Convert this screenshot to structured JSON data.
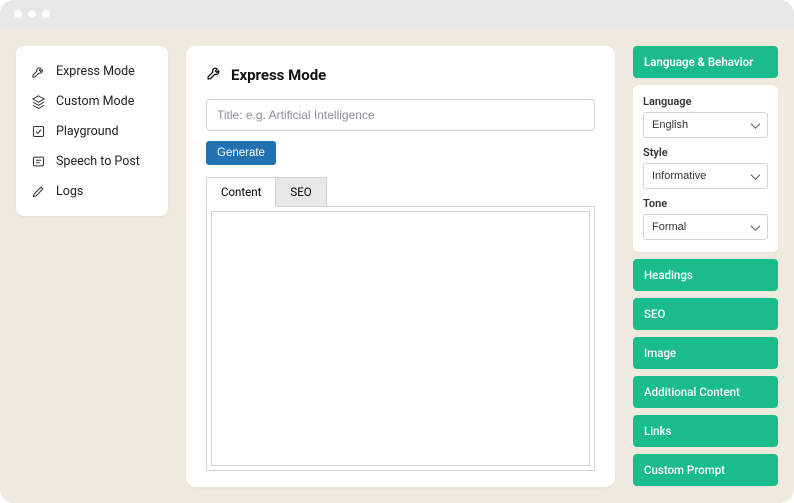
{
  "sidebar": {
    "items": [
      {
        "label": "Express Mode",
        "icon": "wrench"
      },
      {
        "label": "Custom Mode",
        "icon": "layers"
      },
      {
        "label": "Playground",
        "icon": "check-square"
      },
      {
        "label": "Speech to Post",
        "icon": "post"
      },
      {
        "label": "Logs",
        "icon": "pen"
      }
    ]
  },
  "main": {
    "title": "Express Mode",
    "title_placeholder": "Title: e.g. Artificial Intelligence",
    "generate_label": "Generate",
    "tabs": {
      "content": "Content",
      "seo": "SEO"
    },
    "content_value": ""
  },
  "right": {
    "lang_behavior": {
      "header": "Language & Behavior",
      "language_label": "Language",
      "language_value": "English",
      "style_label": "Style",
      "style_value": "Informative",
      "tone_label": "Tone",
      "tone_value": "Formal"
    },
    "accordions": {
      "headings": "Headings",
      "seo": "SEO",
      "image": "Image",
      "additional": "Additional Content",
      "links": "Links",
      "custom": "Custom Prompt"
    }
  },
  "colors": {
    "accent_green": "#1abc8c",
    "button_blue": "#2271b1",
    "bg_beige": "#efeae0"
  }
}
